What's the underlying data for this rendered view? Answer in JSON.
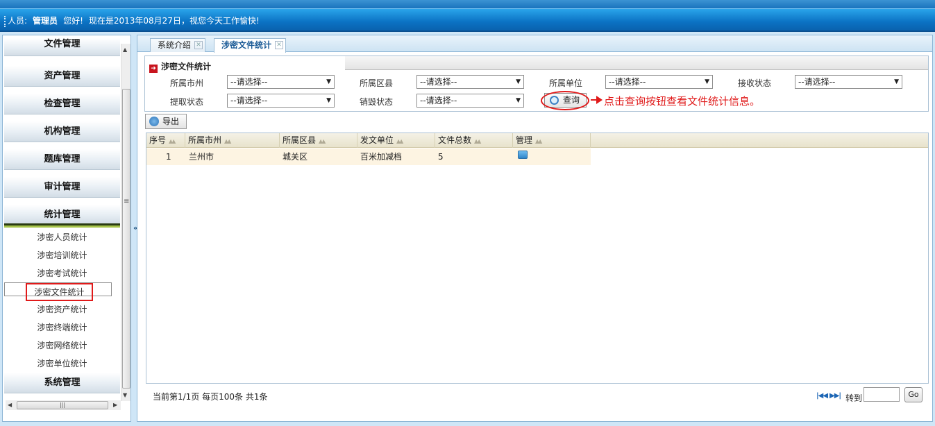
{
  "header": {
    "user_label": "人员:",
    "user_name": "管理员",
    "greeting": "您好!",
    "message": "现在是2013年08月27日，视您今天工作愉快!"
  },
  "sidebar": {
    "menu": [
      {
        "label": "文件管理"
      },
      {
        "label": "资产管理"
      },
      {
        "label": "检查管理"
      },
      {
        "label": "机构管理"
      },
      {
        "label": "题库管理"
      },
      {
        "label": "审计管理"
      },
      {
        "label": "统计管理"
      },
      {
        "label": "系统管理"
      }
    ],
    "sub_items": [
      {
        "label": "涉密人员统计"
      },
      {
        "label": "涉密培训统计"
      },
      {
        "label": "涉密考试统计"
      },
      {
        "label": "涉密文件统计"
      },
      {
        "label": "涉密资产统计"
      },
      {
        "label": "涉密终端统计"
      },
      {
        "label": "涉密网络统计"
      },
      {
        "label": "涉密单位统计"
      }
    ],
    "collapse_glyph": "«"
  },
  "tabs": [
    {
      "label": "系统介绍"
    },
    {
      "label": "涉密文件统计"
    }
  ],
  "search": {
    "title": "涉密文件统计",
    "fields": [
      {
        "label": "所属市州",
        "value": "--请选择--"
      },
      {
        "label": "所属区县",
        "value": "--请选择--"
      },
      {
        "label": "所属单位",
        "value": "--请选择--"
      },
      {
        "label": "接收状态",
        "value": "--请选择--"
      },
      {
        "label": "提取状态",
        "value": "--请选择--"
      },
      {
        "label": "销毁状态",
        "value": "--请选择--"
      }
    ],
    "query_label": "查询",
    "hint": "点击查询按钮查看文件统计信息。"
  },
  "toolbar": {
    "export_label": "导出"
  },
  "table": {
    "columns": [
      "序号",
      "所属市州",
      "所属区县",
      "发文单位",
      "文件总数",
      "管理"
    ],
    "rows": [
      {
        "index": "1",
        "city": "兰州市",
        "district": "城关区",
        "unit": "百米加减档",
        "total": "5"
      }
    ]
  },
  "pager": {
    "info": "当前第1/1页  每页100条  共1条",
    "goto_label": "转到",
    "go_label": "Go"
  },
  "colors": {
    "accent": "#0b72c4",
    "highlight": "#e01a1a",
    "row_bg": "#fdf4e2"
  }
}
